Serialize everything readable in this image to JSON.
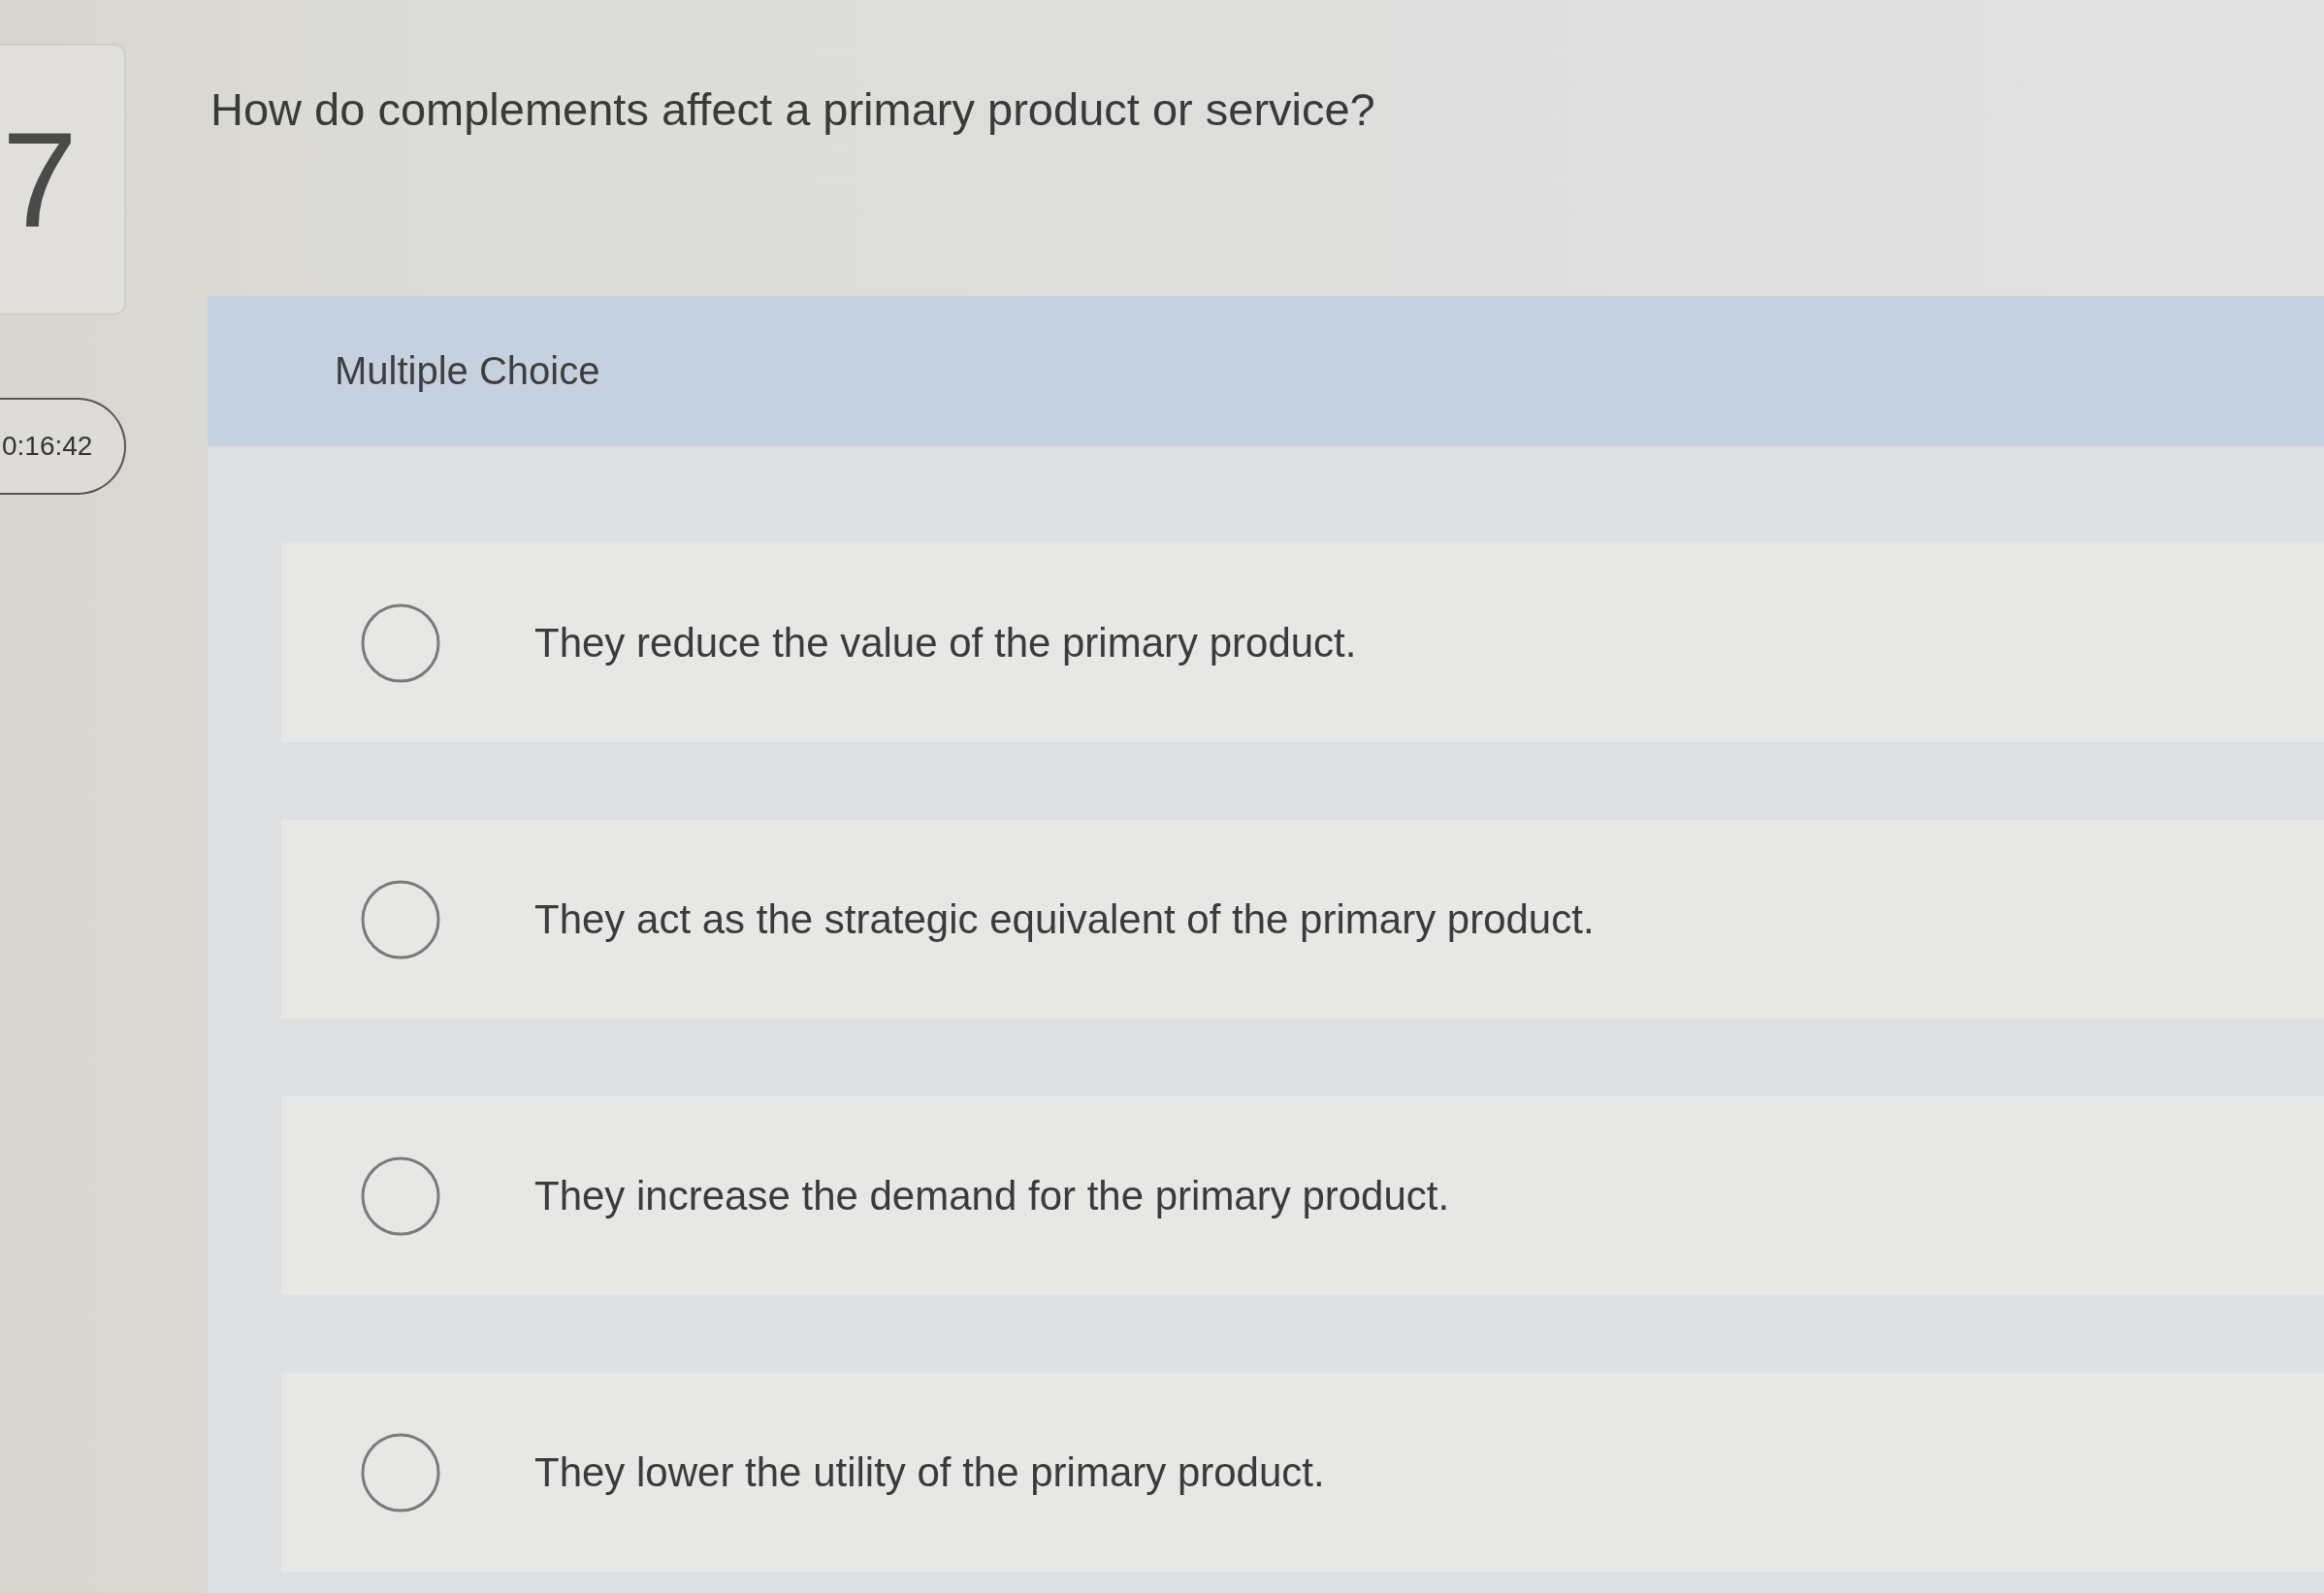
{
  "question": {
    "number": "7",
    "text": "How do complements affect a primary product or service?"
  },
  "timer": "0:16:42",
  "answers": {
    "type_label": "Multiple Choice",
    "options": [
      {
        "label": "They reduce the value of the primary product.",
        "selected": false
      },
      {
        "label": "They act as the strategic equivalent of the primary product.",
        "selected": false
      },
      {
        "label": "They increase the demand for the primary product.",
        "selected": false
      },
      {
        "label": "They lower the utility of the primary product.",
        "selected": false
      }
    ]
  }
}
